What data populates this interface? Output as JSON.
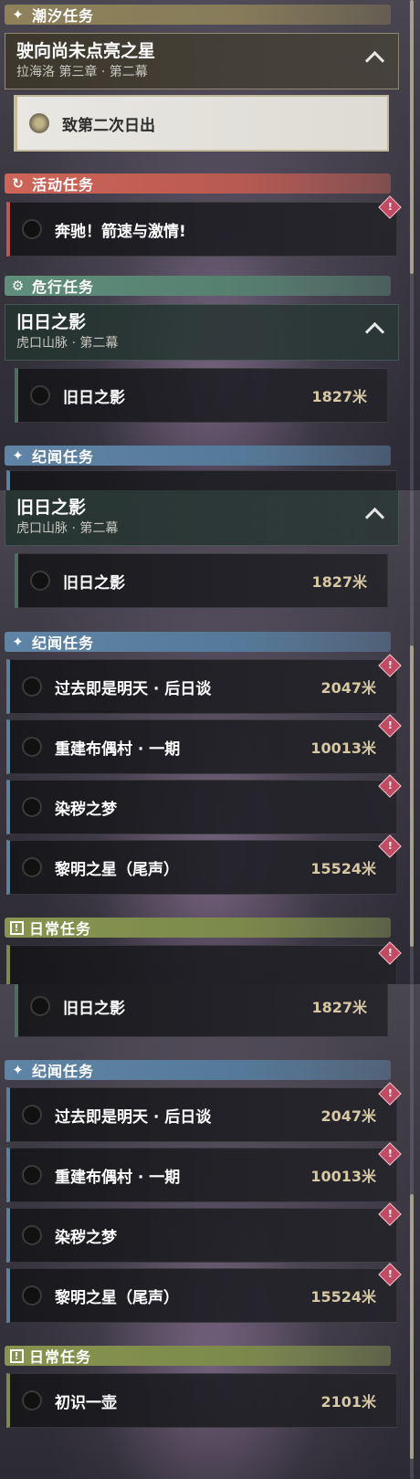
{
  "panel1": {
    "cat_tidal": {
      "label": "潮汐任务",
      "icon": "✦"
    },
    "chapter_star": {
      "title": "驶向尚未点亮之星",
      "subtitle": "拉海洛 第三章 · 第二幕"
    },
    "active_quest": {
      "name": "致第二次日出"
    },
    "cat_event": {
      "label": "活动任务",
      "icon": "↻"
    },
    "quest_event": {
      "name": "奔驰！箭速与激情!",
      "alert": "!"
    },
    "cat_danger": {
      "label": "危行任务",
      "icon": "⚙"
    },
    "chapter_shadow": {
      "title": "旧日之影",
      "subtitle": "虎口山脉 · 第二幕"
    },
    "quest_shadow": {
      "name": "旧日之影",
      "distance": "1827米"
    },
    "cat_chronicle": {
      "label": "纪闻任务",
      "icon": "✦"
    }
  },
  "panel2": {
    "chapter_shadow": {
      "title": "旧日之影",
      "subtitle": "虎口山脉 · 第二幕"
    },
    "quest_shadow": {
      "name": "旧日之影",
      "distance": "1827米"
    },
    "cat_chronicle": {
      "label": "纪闻任务",
      "icon": "✦"
    },
    "quests": [
      {
        "name": "过去即是明天 · 后日谈",
        "distance": "2047米",
        "alert": "!"
      },
      {
        "name": "重建布偶村 · 一期",
        "distance": "10013米",
        "alert": "!"
      },
      {
        "name": "染秽之梦",
        "distance": "",
        "alert": "!"
      },
      {
        "name": "黎明之星（尾声）",
        "distance": "15524米",
        "alert": "!"
      }
    ],
    "cat_daily": {
      "label": "日常任务",
      "icon": "!"
    }
  },
  "panel3": {
    "quest_shadow": {
      "name": "旧日之影",
      "distance": "1827米"
    },
    "cat_chronicle": {
      "label": "纪闻任务",
      "icon": "✦"
    },
    "quests": [
      {
        "name": "过去即是明天 · 后日谈",
        "distance": "2047米",
        "alert": "!"
      },
      {
        "name": "重建布偶村 · 一期",
        "distance": "10013米",
        "alert": "!"
      },
      {
        "name": "染秽之梦",
        "distance": "",
        "alert": "!"
      },
      {
        "name": "黎明之星（尾声）",
        "distance": "15524米",
        "alert": "!"
      }
    ],
    "cat_daily": {
      "label": "日常任务",
      "icon": "!"
    },
    "quest_daily": {
      "name": "初识一壶",
      "distance": "2101米"
    }
  }
}
